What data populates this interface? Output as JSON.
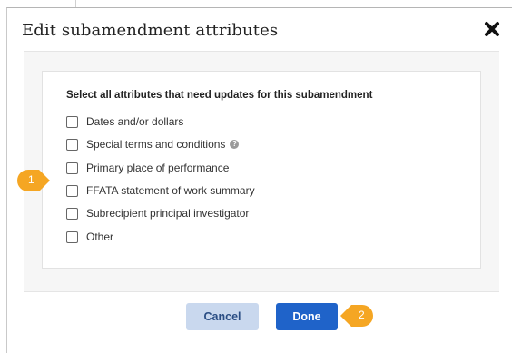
{
  "dialog": {
    "title": "Edit subamendment attributes",
    "close_icon": "close-x-icon"
  },
  "card": {
    "heading": "Select all attributes that need updates for this subamendment",
    "options": [
      {
        "label": "Dates and/or dollars",
        "checked": false
      },
      {
        "label": "Special terms and conditions",
        "checked": false,
        "help_icon": "question-circle-icon"
      },
      {
        "label": "Primary place of performance",
        "checked": false
      },
      {
        "label": "FFATA statement of work summary",
        "checked": false
      },
      {
        "label": "Subrecipient principal investigator",
        "checked": false
      },
      {
        "label": "Other",
        "checked": false
      }
    ]
  },
  "footer": {
    "cancel_label": "Cancel",
    "done_label": "Done"
  },
  "callouts": [
    {
      "number": "1"
    },
    {
      "number": "2"
    }
  ],
  "colors": {
    "accent": "#1f63c9",
    "cancel_bg": "#c9d8ee",
    "callout": "#f5a623"
  }
}
